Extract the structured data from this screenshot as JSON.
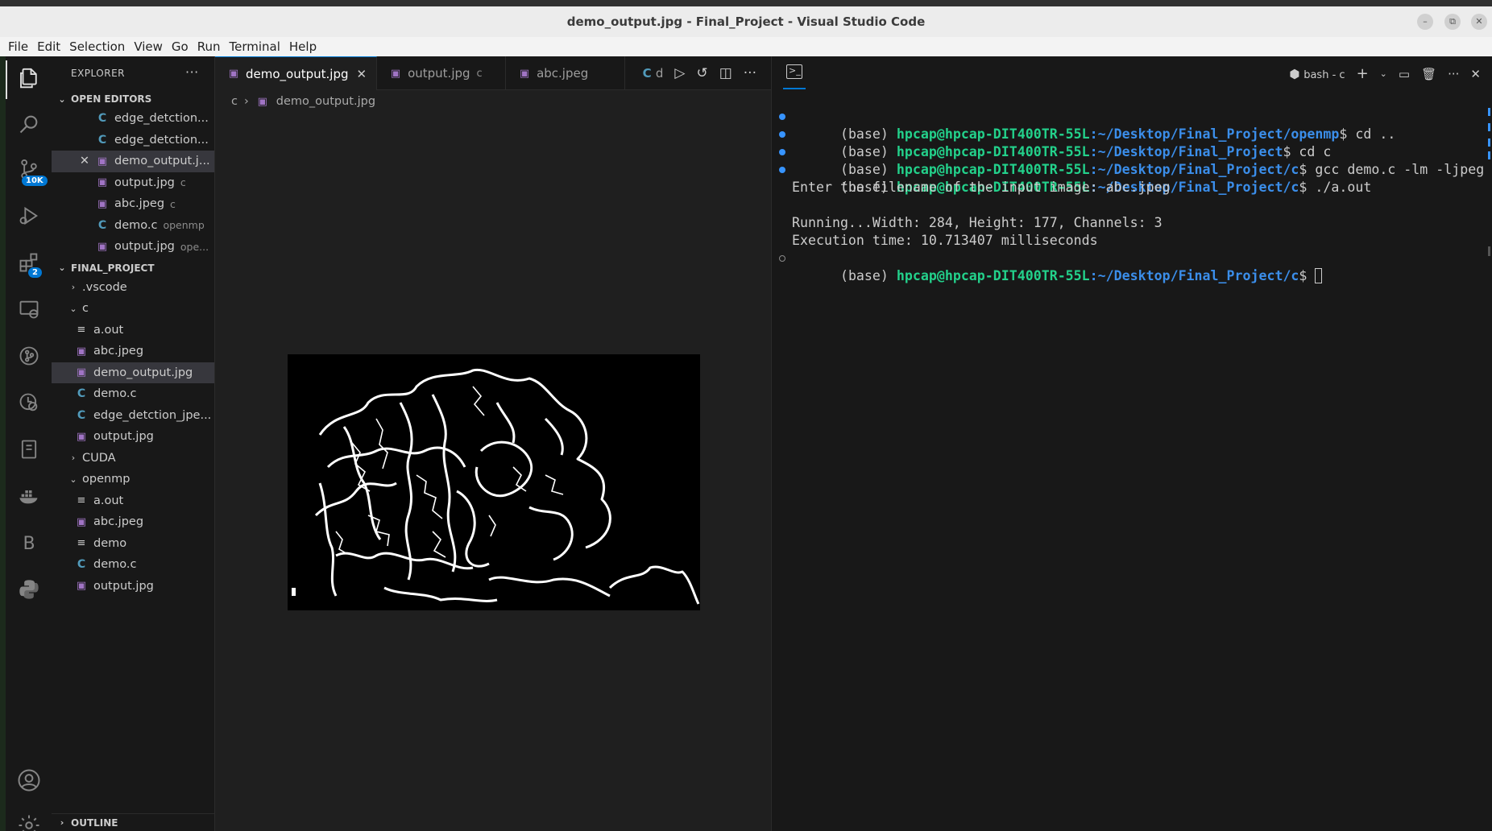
{
  "window": {
    "title": "demo_output.jpg - Final_Project - Visual Studio Code",
    "controls": [
      "–",
      "⧉",
      "✕"
    ]
  },
  "menu": [
    "File",
    "Edit",
    "Selection",
    "View",
    "Go",
    "Run",
    "Terminal",
    "Help"
  ],
  "activity": {
    "scm_badge": "10K",
    "extensions_badge": "2",
    "b_label": "B"
  },
  "explorer": {
    "header": "EXPLORER",
    "open_editors_label": "OPEN EDITORS",
    "open_editors": [
      {
        "name": "edge_detction...",
        "desc": "",
        "icon": "c-file-icon"
      },
      {
        "name": "edge_detction...",
        "desc": "",
        "icon": "c-file-icon"
      },
      {
        "name": "demo_output.j...",
        "desc": "",
        "icon": "image-file-icon"
      },
      {
        "name": "output.jpg",
        "desc": "c",
        "icon": "image-file-icon"
      },
      {
        "name": "abc.jpeg",
        "desc": "c",
        "icon": "image-file-icon"
      },
      {
        "name": "demo.c",
        "desc": "openmp",
        "icon": "c-file-icon"
      },
      {
        "name": "output.jpg",
        "desc": "ope...",
        "icon": "image-file-icon"
      }
    ],
    "project_label": "FINAL_PROJECT",
    "tree": {
      "vscode": ".vscode",
      "c_folder": "c",
      "c_files": [
        "a.out",
        "abc.jpeg",
        "demo_output.jpg",
        "demo.c",
        "edge_detction_jpe...",
        "output.jpg"
      ],
      "cuda": "CUDA",
      "openmp": "openmp",
      "openmp_files": [
        "a.out",
        "abc.jpeg",
        "demo",
        "demo.c",
        "output.jpg"
      ]
    },
    "outline_label": "OUTLINE"
  },
  "editor": {
    "tabs": [
      {
        "label": "demo_output.jpg",
        "desc": ""
      },
      {
        "label": "output.jpg",
        "desc": "c"
      },
      {
        "label": "abc.jpeg",
        "desc": ""
      },
      {
        "label": "d",
        "desc": ""
      }
    ],
    "breadcrumb": [
      "c",
      "demo_output.jpg"
    ]
  },
  "terminal": {
    "shell_label": "bash - c",
    "lines": [
      {
        "prefix": "(base) ",
        "user": "hpcap@hpcap-DIT400TR-55L",
        "path": ":~/Desktop/Final_Project/openmp",
        "cmd": "$ cd .."
      },
      {
        "prefix": "(base) ",
        "user": "hpcap@hpcap-DIT400TR-55L",
        "path": ":~/Desktop/Final_Project",
        "cmd": "$ cd c"
      },
      {
        "prefix": "(base) ",
        "user": "hpcap@hpcap-DIT400TR-55L",
        "path": ":~/Desktop/Final_Project/c",
        "cmd": "$ gcc demo.c -lm -ljpeg"
      },
      {
        "prefix": "(base) ",
        "user": "hpcap@hpcap-DIT400TR-55L",
        "path": ":~/Desktop/Final_Project/c",
        "cmd": "$ ./a.out"
      }
    ],
    "output": [
      "Enter the filename of the input image: abc.jpeg",
      "",
      "Running...Width: 284, Height: 177, Channels: 3",
      "Execution time: 10.713407 milliseconds"
    ],
    "prompt": {
      "prefix": "(base) ",
      "user": "hpcap@hpcap-DIT400TR-55L",
      "path": ":~/Desktop/Final_Project/c",
      "cmd": "$ "
    }
  }
}
